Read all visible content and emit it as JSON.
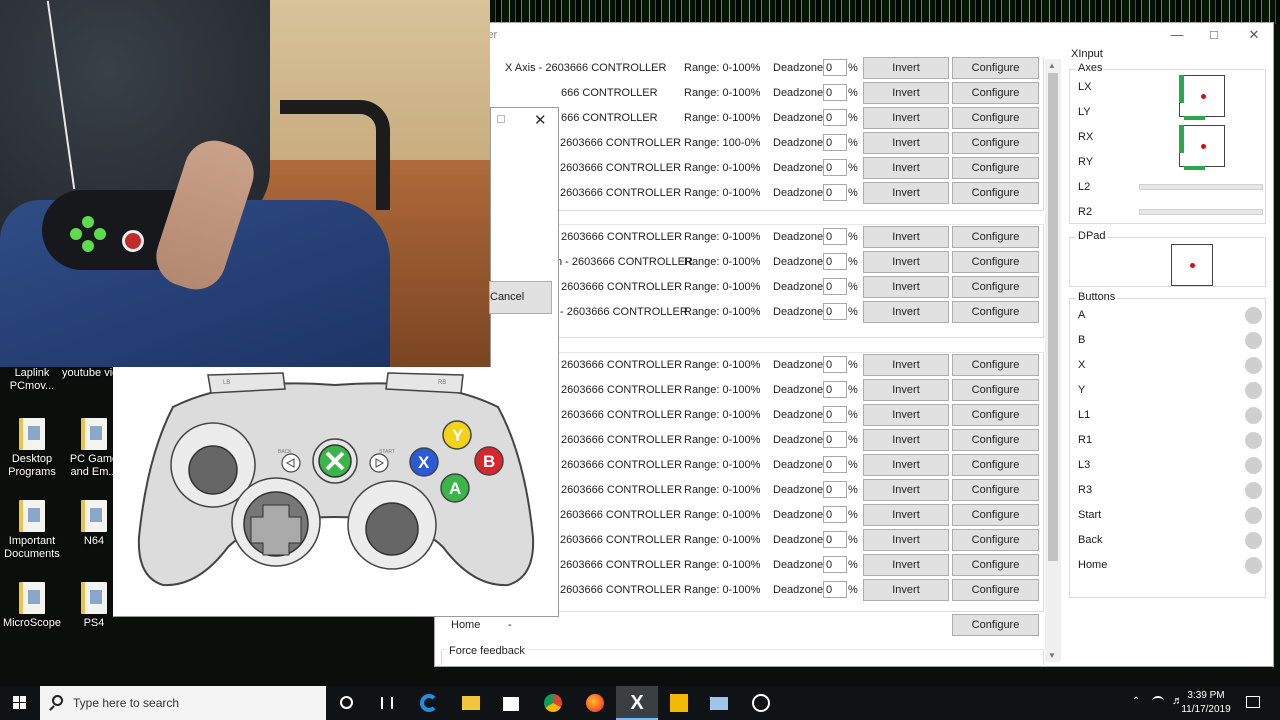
{
  "desktop": {
    "icons": [
      {
        "label": "Laplink PCmov..."
      },
      {
        "label": "youtube video stu..."
      },
      {
        "label": "Desktop Programs"
      },
      {
        "label": "PC Game and Em..."
      },
      {
        "label": "Important Documents"
      },
      {
        "label": "N64"
      },
      {
        "label": "MicroScope"
      },
      {
        "label": "PS4"
      }
    ]
  },
  "dialog": {
    "cancel_label": "Cancel"
  },
  "gamepad": {
    "back_label": "BACK",
    "start_label": "START",
    "lb_label": "LB",
    "rb_label": "RB",
    "button_y": "Y",
    "button_x": "X",
    "button_b": "B",
    "button_a": "A",
    "colors": {
      "y": "#f2d21b",
      "x": "#2a5bd7",
      "b": "#d8252e",
      "a": "#3ab54a",
      "guide": "#3ab54a"
    }
  },
  "main": {
    "title": "ler",
    "groups": [
      {
        "rows": [
          {
            "name": "X Axis - 2603666 CONTROLLER",
            "range": "Range: 0-100%",
            "deadzone": "0"
          },
          {
            "name": "666 CONTROLLER",
            "range": "Range: 0-100%",
            "deadzone": "0"
          },
          {
            "name": "666 CONTROLLER",
            "range": "Range: 0-100%",
            "deadzone": "0"
          },
          {
            "name": "2603666 CONTROLLER",
            "range": "Range: 100-0%",
            "deadzone": "0"
          },
          {
            "name": "2603666 CONTROLLER",
            "range": "Range: 0-100%",
            "deadzone": "0"
          },
          {
            "name": "2603666 CONTROLLER",
            "range": "Range: 0-100%",
            "deadzone": "0"
          }
        ]
      },
      {
        "rows": [
          {
            "name": "2603666 CONTROLLER",
            "range": "Range: 0-100%",
            "deadzone": "0"
          },
          {
            "name": "n - 2603666 CONTROLLER",
            "range": "Range: 0-100%",
            "deadzone": "0"
          },
          {
            "name": "2603666 CONTROLLER",
            "range": "Range: 0-100%",
            "deadzone": "0"
          },
          {
            "name": "- 2603666 CONTROLLER",
            "range": "Range: 0-100%",
            "deadzone": "0"
          }
        ]
      },
      {
        "rows": [
          {
            "name": "2603666 CONTROLLER",
            "range": "Range: 0-100%",
            "deadzone": "0"
          },
          {
            "name": "2603666 CONTROLLER",
            "range": "Range: 0-100%",
            "deadzone": "0"
          },
          {
            "name": "2603666 CONTROLLER",
            "range": "Range: 0-100%",
            "deadzone": "0"
          },
          {
            "name": "2603666 CONTROLLER",
            "range": "Range: 0-100%",
            "deadzone": "0"
          },
          {
            "name": "2603666 CONTROLLER",
            "range": "Range: 0-100%",
            "deadzone": "0"
          },
          {
            "name": "2603666 CONTROLLER",
            "range": "Range: 0-100%",
            "deadzone": "0"
          },
          {
            "name": "2603666 CONTROLLER",
            "range": "Range: 0-100%",
            "deadzone": "0"
          },
          {
            "name": "2603666 CONTROLLER",
            "range": "Range: 0-100%",
            "deadzone": "0"
          },
          {
            "name": "2603666 CONTROLLER",
            "range": "Range: 0-100%",
            "deadzone": "0"
          },
          {
            "name": "2603666 CONTROLLER",
            "range": "Range: 0-100%",
            "deadzone": "0"
          }
        ]
      }
    ],
    "labels": {
      "deadzone": "Deadzone:",
      "percent": "%",
      "invert": "Invert",
      "configure": "Configure"
    },
    "home_row": {
      "name": "Home",
      "value": "-"
    },
    "force_feedback": "Force feedback"
  },
  "xinput": {
    "title": "XInput",
    "axes_label": "Axes",
    "axes": [
      "LX",
      "LY",
      "RX",
      "RY",
      "L2",
      "R2"
    ],
    "dpad_label": "DPad",
    "buttons_label": "Buttons",
    "buttons": [
      "A",
      "B",
      "X",
      "Y",
      "L1",
      "R1",
      "L3",
      "R3",
      "Start",
      "Back",
      "Home"
    ],
    "stick_active_color": "#2aa84a",
    "dot_color": "#d01010"
  },
  "taskbar": {
    "search_placeholder": "Type here to search",
    "time": "3:39 PM",
    "date": "11/17/2019",
    "apps": [
      "cortana-icon",
      "task-view-icon",
      "edge-icon",
      "file-explorer-icon",
      "store-icon",
      "chrome-icon",
      "firefox-icon",
      "x360ce-icon",
      "rockstar-icon",
      "remote-icon",
      "steam-icon"
    ]
  }
}
